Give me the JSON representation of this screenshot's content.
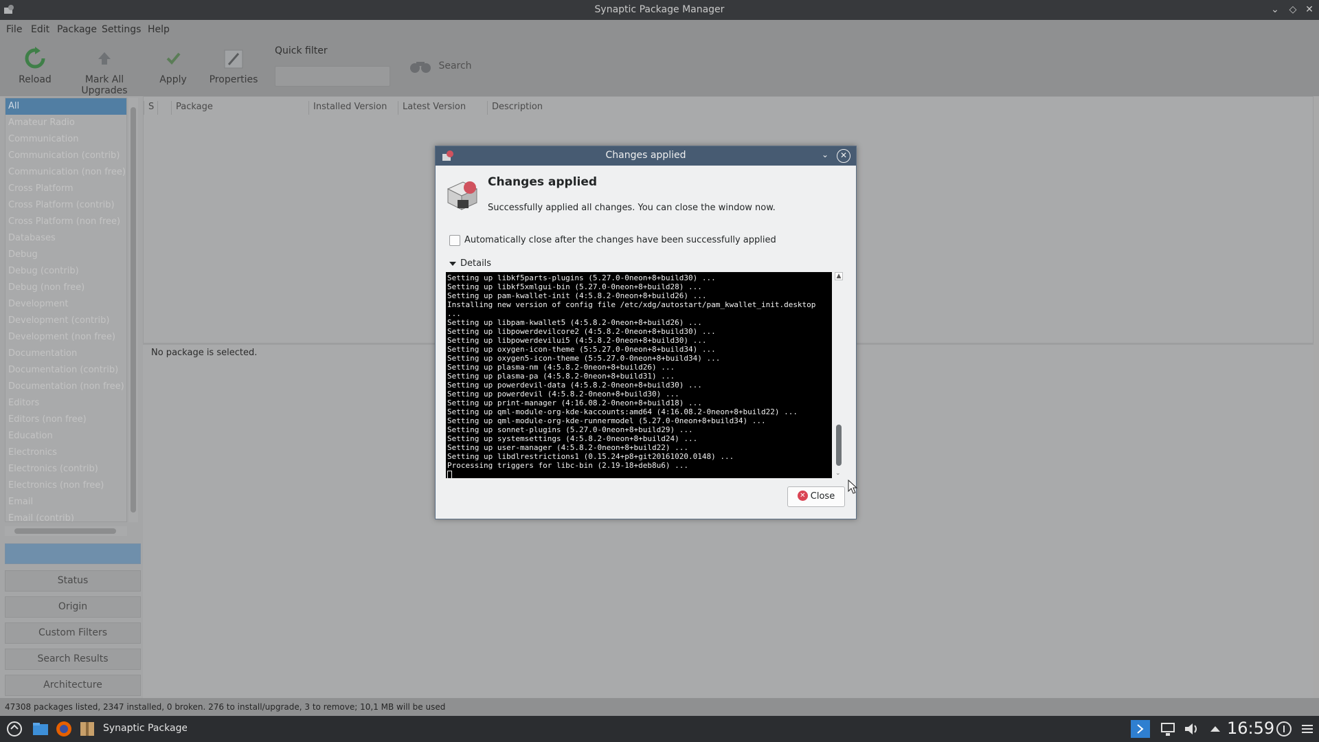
{
  "window": {
    "title": "Synaptic Package Manager"
  },
  "menu": [
    "File",
    "Edit",
    "Package",
    "Settings",
    "Help"
  ],
  "toolbar": {
    "reload": "Reload",
    "mark_all_upgrades": "Mark All Upgrades",
    "apply": "Apply",
    "properties": "Properties",
    "quick_filter_label": "Quick filter",
    "quick_filter_value": "",
    "search": "Search"
  },
  "categories": [
    "All",
    "Amateur Radio",
    "Communication",
    "Communication (contrib)",
    "Communication (non free)",
    "Cross Platform",
    "Cross Platform (contrib)",
    "Cross Platform (non free)",
    "Databases",
    "Debug",
    "Debug (contrib)",
    "Debug (non free)",
    "Development",
    "Development (contrib)",
    "Development (non free)",
    "Documentation",
    "Documentation (contrib)",
    "Documentation (non free)",
    "Editors",
    "Editors (non free)",
    "Education",
    "Electronics",
    "Electronics (contrib)",
    "Electronics (non free)",
    "Email",
    "Email (contrib)"
  ],
  "filter_buttons": [
    "Status",
    "Origin",
    "Custom Filters",
    "Search Results",
    "Architecture"
  ],
  "table": {
    "columns": [
      "S",
      "Package",
      "Installed Version",
      "Latest Version",
      "Description"
    ]
  },
  "details": {
    "empty_message": "No package is selected."
  },
  "status_bar": "47308 packages listed, 2347 installed, 0 broken. 276 to install/upgrade, 3 to remove; 10,1 MB will be used",
  "taskbar": {
    "task_title": "Synaptic Package M",
    "clock": "16:59"
  },
  "dialog": {
    "title": "Changes applied",
    "heading": "Changes applied",
    "subtitle": "Successfully applied all changes. You can close the window now.",
    "auto_close_label": "Automatically close after the changes have been successfully applied",
    "auto_close_checked": false,
    "details_label": "Details",
    "close_button": "Close",
    "terminal_lines": [
      "Setting up libkf5parts-plugins (5.27.0-0neon+8+build30) ...",
      "Setting up libkf5xmlgui-bin (5.27.0-0neon+8+build28) ...",
      "Setting up pam-kwallet-init (4:5.8.2-0neon+8+build26) ...",
      "Installing new version of config file /etc/xdg/autostart/pam_kwallet_init.desktop ...",
      "Setting up libpam-kwallet5 (4:5.8.2-0neon+8+build26) ...",
      "Setting up libpowerdevilcore2 (4:5.8.2-0neon+8+build30) ...",
      "Setting up libpowerdevilui5 (4:5.8.2-0neon+8+build30) ...",
      "Setting up oxygen-icon-theme (5:5.27.0-0neon+8+build34) ...",
      "Setting up oxygen5-icon-theme (5:5.27.0-0neon+8+build34) ...",
      "Setting up plasma-nm (4:5.8.2-0neon+8+build26) ...",
      "Setting up plasma-pa (4:5.8.2-0neon+8+build31) ...",
      "Setting up powerdevil-data (4:5.8.2-0neon+8+build30) ...",
      "Setting up powerdevil (4:5.8.2-0neon+8+build30) ...",
      "Setting up print-manager (4:16.08.2-0neon+8+build18) ...",
      "Setting up qml-module-org-kde-kaccounts:amd64 (4:16.08.2-0neon+8+build22) ...",
      "Setting up qml-module-org-kde-runnermodel (5.27.0-0neon+8+build34) ...",
      "Setting up sonnet-plugins (5.27.0-0neon+8+build29) ...",
      "Setting up systemsettings (4:5.8.2-0neon+8+build24) ...",
      "Setting up user-manager (4:5.8.2-0neon+8+build22) ...",
      "Setting up libdlrestrictions1 (0.15.24+p8+git20161020.0148) ...",
      "Processing triggers for libc-bin (2.19-18+deb8u6) ..."
    ]
  },
  "colors": {
    "selection": "#517ea3",
    "dialog_titlebar": "#475b72",
    "close_icon": "#da4453"
  }
}
